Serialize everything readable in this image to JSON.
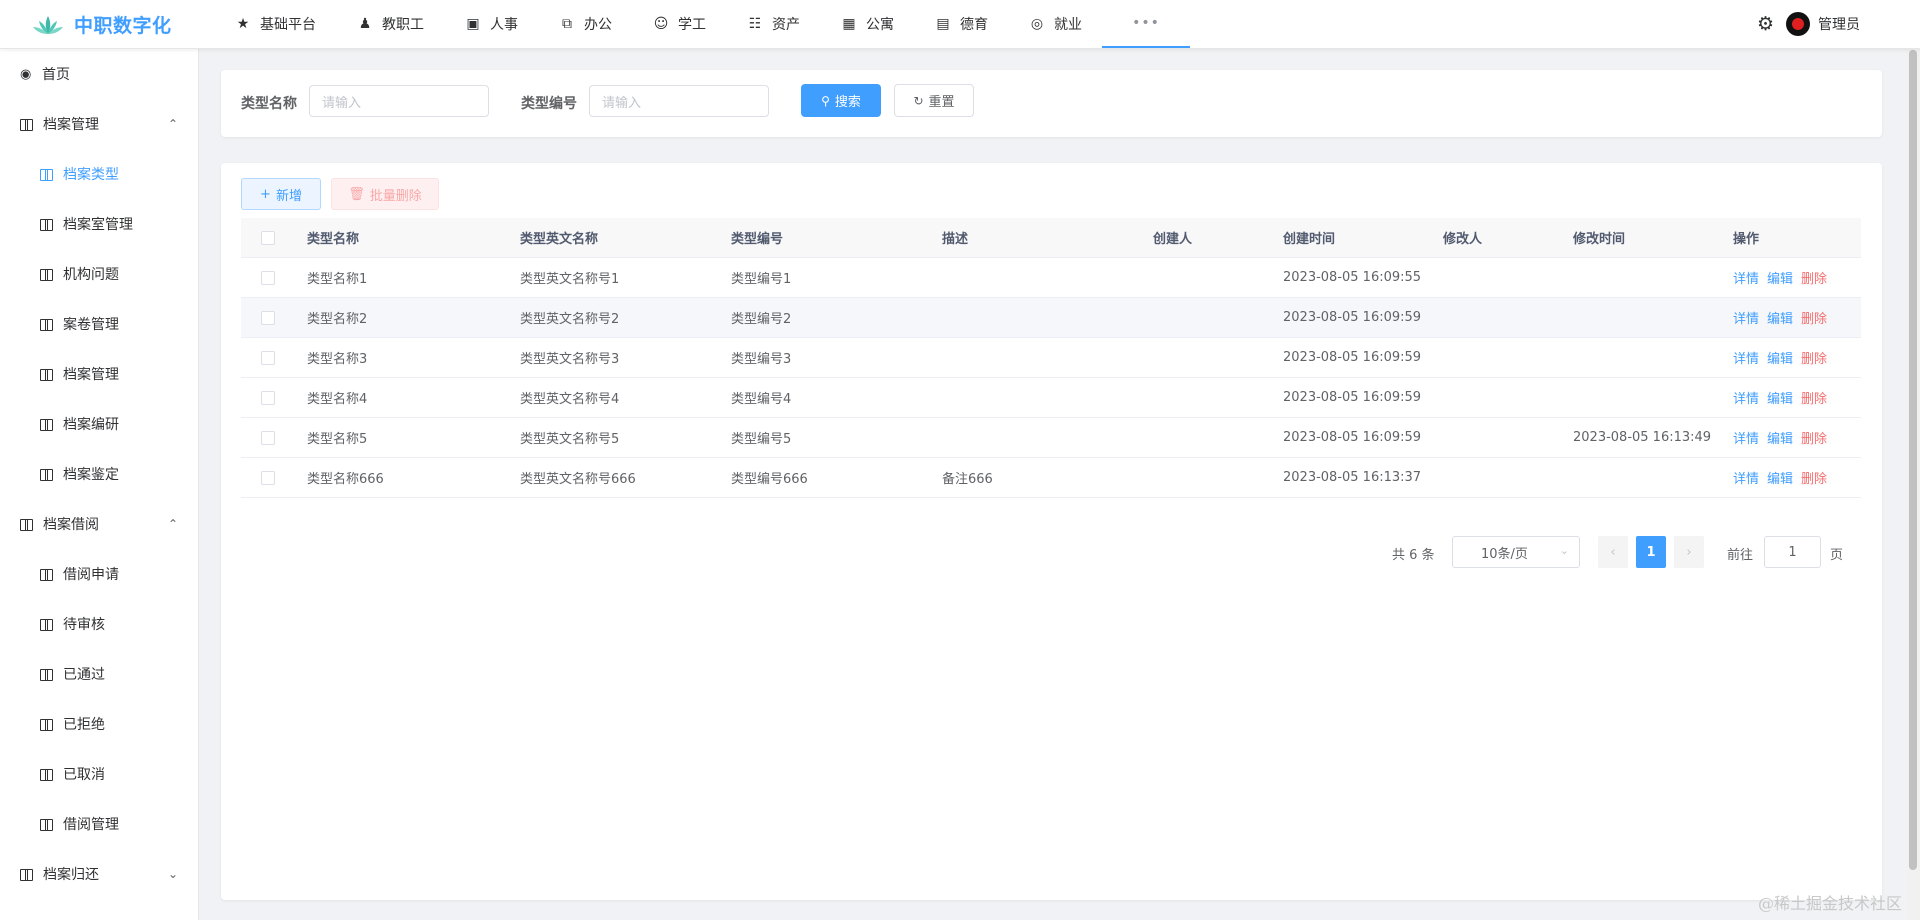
{
  "app": {
    "title": "中职数字化"
  },
  "topnav": [
    {
      "label": "基础平台",
      "icon": "★"
    },
    {
      "label": "教职工",
      "icon": "👥"
    },
    {
      "label": "人事",
      "icon": "▣"
    },
    {
      "label": "办公",
      "icon": "⧉"
    },
    {
      "label": "学工",
      "icon": "☺"
    },
    {
      "label": "资产",
      "icon": "☷"
    },
    {
      "label": "公寓",
      "icon": "▦"
    },
    {
      "label": "德育",
      "icon": "▤"
    },
    {
      "label": "就业",
      "icon": "◎"
    }
  ],
  "topnav_more": "•••",
  "user": {
    "name": "管理员"
  },
  "sidebar": {
    "home": "首页",
    "group1": "档案管理",
    "group1_items": [
      "档案类型",
      "档案室管理",
      "机构问题",
      "案卷管理",
      "档案管理",
      "档案编研",
      "档案鉴定"
    ],
    "group2": "档案借阅",
    "group2_items": [
      "借阅申请",
      "待审核",
      "已通过",
      "已拒绝",
      "已取消",
      "借阅管理"
    ],
    "group3": "档案归还"
  },
  "search": {
    "type_name_label": "类型名称",
    "type_name_placeholder": "请输入",
    "type_code_label": "类型编号",
    "type_code_placeholder": "请输入",
    "search_btn": "搜索",
    "reset_btn": "重置"
  },
  "toolbar": {
    "add": "新增",
    "batch_delete": "批量删除"
  },
  "table": {
    "columns": [
      "类型名称",
      "类型英文名称",
      "类型编号",
      "描述",
      "创建人",
      "创建时间",
      "修改人",
      "修改时间",
      "操作"
    ],
    "rows": [
      {
        "name": "类型名称1",
        "en": "类型英文名称号1",
        "code": "类型编号1",
        "desc": "",
        "creator": "",
        "ctime": "2023-08-05 16:09:55",
        "editor": "",
        "mtime": ""
      },
      {
        "name": "类型名称2",
        "en": "类型英文名称号2",
        "code": "类型编号2",
        "desc": "",
        "creator": "",
        "ctime": "2023-08-05 16:09:59",
        "editor": "",
        "mtime": ""
      },
      {
        "name": "类型名称3",
        "en": "类型英文名称号3",
        "code": "类型编号3",
        "desc": "",
        "creator": "",
        "ctime": "2023-08-05 16:09:59",
        "editor": "",
        "mtime": ""
      },
      {
        "name": "类型名称4",
        "en": "类型英文名称号4",
        "code": "类型编号4",
        "desc": "",
        "creator": "",
        "ctime": "2023-08-05 16:09:59",
        "editor": "",
        "mtime": ""
      },
      {
        "name": "类型名称5",
        "en": "类型英文名称号5",
        "code": "类型编号5",
        "desc": "",
        "creator": "",
        "ctime": "2023-08-05 16:09:59",
        "editor": "",
        "mtime": "2023-08-05 16:13:49"
      },
      {
        "name": "类型名称666",
        "en": "类型英文名称号666",
        "code": "类型编号666",
        "desc": "备注666",
        "creator": "",
        "ctime": "2023-08-05 16:13:37",
        "editor": "",
        "mtime": ""
      }
    ],
    "ops": {
      "detail": "详情",
      "edit": "编辑",
      "delete": "删除"
    }
  },
  "pagination": {
    "total": "共 6 条",
    "page_size": "10条/页",
    "current_page": "1",
    "goto_label": "前往",
    "goto_value": "1",
    "page_unit": "页"
  },
  "watermark": "@稀土掘金技术社区",
  "colors": {
    "primary": "#409eff",
    "danger": "#f56c6c"
  }
}
